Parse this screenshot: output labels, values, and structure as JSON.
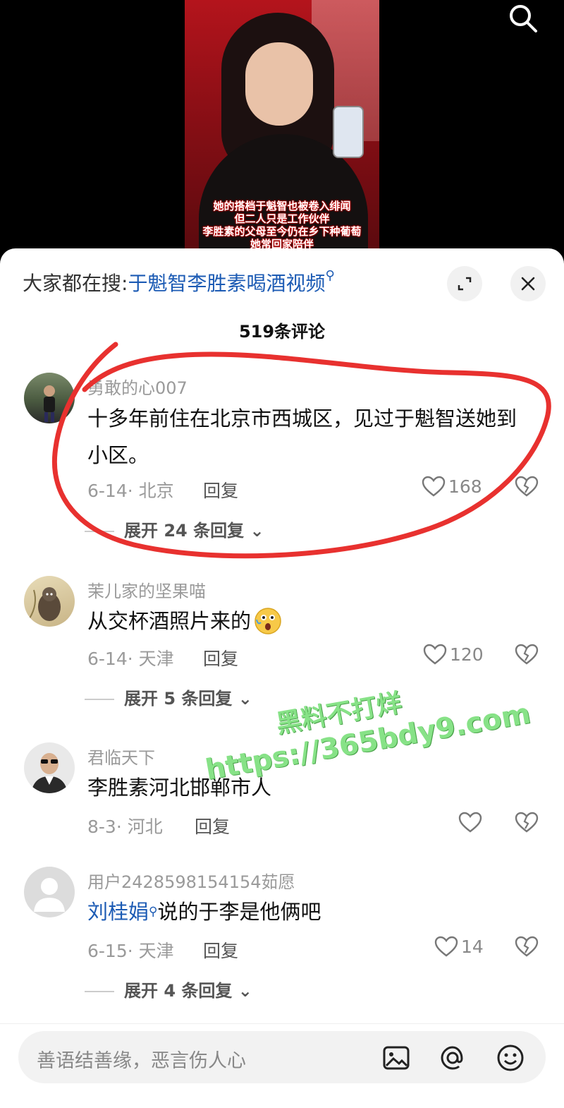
{
  "video": {
    "caption_lines": [
      "她的搭档于魁智也被卷入绯闻",
      "但二人只是工作伙伴",
      "李胜素的父母至今仍在乡下种葡萄",
      "她常回家陪伴"
    ]
  },
  "header": {
    "hot_search_label": "大家都在搜:",
    "hot_search_term": "于魁智李胜素喝酒视频",
    "hot_search_icon": "search-small-icon"
  },
  "comments_count": "519条评论",
  "comments": [
    {
      "user": "勇敢的心007",
      "text": "十多年前住在北京市西城区，见过于魁智送她到小区。",
      "date_loc": "6-14· 北京",
      "reply": "回复",
      "likes": "168",
      "expand": "展开 24 条回复"
    },
    {
      "user": "茉儿家的坚果喵",
      "text": "从交杯酒照片来的",
      "date_loc": "6-14· 天津",
      "reply": "回复",
      "likes": "120",
      "expand": "展开 5 条回复"
    },
    {
      "user": "君临天下",
      "text": "李胜素河北邯郸市人",
      "date_loc": "8-3· 河北",
      "reply": "回复",
      "likes": "",
      "expand": ""
    },
    {
      "user": "用户2428598154154茹愿",
      "mention": "刘桂娟",
      "text": "说的于李是他俩吧",
      "date_loc": "6-15· 天津",
      "reply": "回复",
      "likes": "14",
      "expand": "展开 4 条回复"
    }
  ],
  "watermark": {
    "line1": "黑料不打烊",
    "line2": "https://365bdy9.com"
  },
  "input": {
    "placeholder": "善语结善缘，恶言伤人心"
  },
  "colors": {
    "link": "#1c5bb4",
    "annotation": "#e8312f",
    "watermark": "#7de07d"
  }
}
